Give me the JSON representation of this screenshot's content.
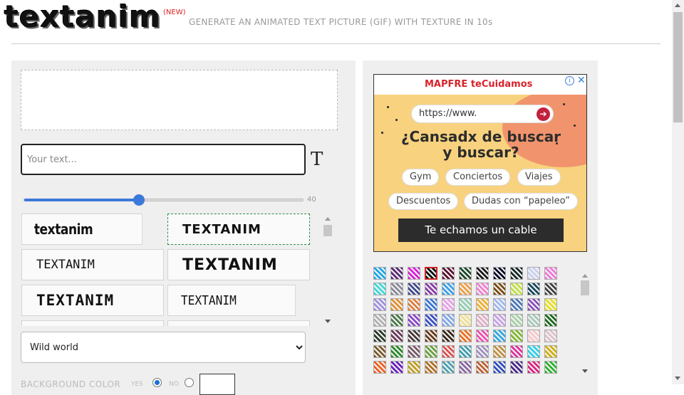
{
  "header": {
    "logo": "textanim",
    "new_badge": "(NEW)",
    "tagline": "GENERATE AN ANIMATED TEXT PICTURE (GIF) WITH TEXTURE IN 10s"
  },
  "editor": {
    "text_placeholder": "Your text...",
    "text_value": "",
    "font_size_icon": "text-size-icon",
    "size_slider": {
      "value": 40,
      "min": 0,
      "max": 100,
      "fraction": 0.41,
      "label": "40"
    },
    "fonts": [
      {
        "label": "textanim",
        "selected": false
      },
      {
        "label": "TEXTANIM",
        "selected": true
      },
      {
        "label": "TEXTANIM",
        "selected": false
      },
      {
        "label": "TEXTANIM",
        "selected": false
      },
      {
        "label": "TEXTANIM",
        "selected": false
      },
      {
        "label": "TEXTANIM",
        "selected": false
      }
    ],
    "texture_select": {
      "selected": "Wild world",
      "options": [
        "Wild world"
      ]
    },
    "background": {
      "label": "BACKGROUND COLOR",
      "yes": "YES",
      "no": "NO",
      "selected": "yes",
      "color": "#ffffff"
    }
  },
  "ad": {
    "brand": "MAPFRE teCuidamos",
    "url": "https://www.",
    "headline": "¿Cansadx de buscar y buscar?",
    "chips": [
      "Gym",
      "Conciertos",
      "Viajes",
      "Descuentos",
      "Dudas con “papeleo”"
    ],
    "cta": "Te echamos un cable",
    "info_icon": "info-icon",
    "close_icon": "close-icon"
  },
  "colors": {
    "accent": "#3b7ad8",
    "ad_background": "#f8d27e",
    "ad_brand": "#d8232a",
    "selected_font_border": "#2a8a4a",
    "selected_swatch_border": "#cc2222"
  },
  "textures": {
    "selected_index": 3,
    "swatches": [
      "#1ea7e8",
      "#5c2a78",
      "#d81ed8",
      "#111111",
      "#5a1030",
      "#1f4a2a",
      "#1a1a1a",
      "#0a0a2a",
      "#1a2a2a",
      "#c8d0f0",
      "#f078d8",
      "#40d8d8",
      "#8a8a9a",
      "#404a8a",
      "#8a3aa8",
      "#3aa0e8",
      "#f0a040",
      "#f080d0",
      "#7a4a10",
      "#c0e040",
      "#1a4a5a",
      "#404040",
      "#a090e0",
      "#e09030",
      "#e08040",
      "#3a78d8",
      "#e8a0e8",
      "#90d0b0",
      "#f0b030",
      "#a0b8f0",
      "#4a7ab8",
      "#8a50b8",
      "#e8e020",
      "#b0b0b0",
      "#4a7a4a",
      "#8a48c8",
      "#3a50c8",
      "#80a8e8",
      "#f0e090",
      "#e0b0c8",
      "#c8a0e8",
      "#a8d0a8",
      "#a8c8b8",
      "#1a6a1a",
      "#2a3a2a",
      "#6a3a5a",
      "#4a3a3a",
      "#6a3a1a",
      "#3a2a1a",
      "#f07020",
      "#f050b0",
      "#30a8e0",
      "#80b830",
      "#f8c8c8",
      "#e0c0c8",
      "#7a5a2a",
      "#2a8a2a",
      "#7a5a6a",
      "#6aa040",
      "#e05050",
      "#40a0b0",
      "#a090c0",
      "#c09040",
      "#e030a0",
      "#30d0e8",
      "#d0b010",
      "#f06020",
      "#6a20c0",
      "#c0a020",
      "#b07020",
      "#50a0b0",
      "#8a68a0",
      "#c06030",
      "#3050c0",
      "#4a2a8a",
      "#e02080",
      "#30b030"
    ]
  }
}
